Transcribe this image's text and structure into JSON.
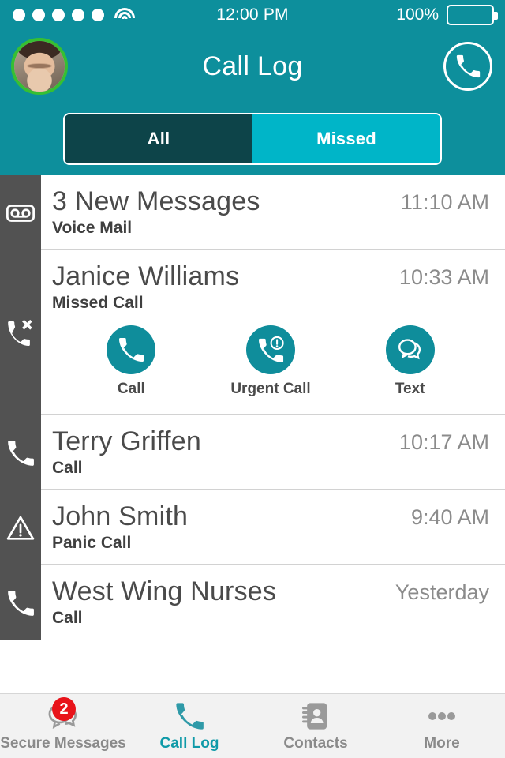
{
  "status_bar": {
    "signal_dots": 5,
    "wifi_icon": "wifi-icon",
    "time": "12:00 PM",
    "battery_percent": "100%",
    "battery_icon": "battery-full-icon"
  },
  "header": {
    "title": "Call Log",
    "avatar_name": "user-avatar",
    "avatar_status_color": "#36bf33",
    "call_button_icon": "phone-icon",
    "background_color": "#0d8f9c"
  },
  "segmented_control": {
    "selected": "All",
    "options": [
      {
        "label": "All",
        "selected": true,
        "color": "#0d4449"
      },
      {
        "label": "Missed",
        "selected": false,
        "color": "#00b5c8"
      }
    ]
  },
  "call_log": {
    "rows": [
      {
        "title": "3 New Messages",
        "subtitle": "Voice Mail",
        "time": "11:10 AM",
        "icon": "voicemail-icon",
        "expanded": false
      },
      {
        "title": "Janice Williams",
        "subtitle": "Missed Call",
        "time": "10:33 AM",
        "icon": "missed-call-icon",
        "expanded": true,
        "actions": [
          {
            "label": "Call",
            "icon": "phone-icon"
          },
          {
            "label": "Urgent Call",
            "icon": "urgent-phone-icon"
          },
          {
            "label": "Text",
            "icon": "chat-bubbles-icon"
          }
        ]
      },
      {
        "title": "Terry Griffen",
        "subtitle": "Call",
        "time": "10:17 AM",
        "icon": "phone-icon",
        "expanded": false
      },
      {
        "title": "John Smith",
        "subtitle": "Panic Call",
        "time": "9:40 AM",
        "icon": "warning-triangle-icon",
        "expanded": false
      },
      {
        "title": "West Wing Nurses",
        "subtitle": "Call",
        "time": "Yesterday",
        "icon": "phone-icon",
        "expanded": false
      }
    ],
    "action_button_color": "#0f8d9b"
  },
  "tab_bar": {
    "active": "Call Log",
    "tabs": [
      {
        "label": "Secure Messages",
        "icon": "chat-bubbles-icon",
        "badge": "2",
        "active": false
      },
      {
        "label": "Call Log",
        "icon": "phone-icon",
        "badge": null,
        "active": true
      },
      {
        "label": "Contacts",
        "icon": "contacts-book-icon",
        "badge": null,
        "active": false
      },
      {
        "label": "More",
        "icon": "ellipsis-icon",
        "badge": null,
        "active": false
      }
    ],
    "badge_color": "#e8131a",
    "active_color": "#0f9aa8"
  }
}
